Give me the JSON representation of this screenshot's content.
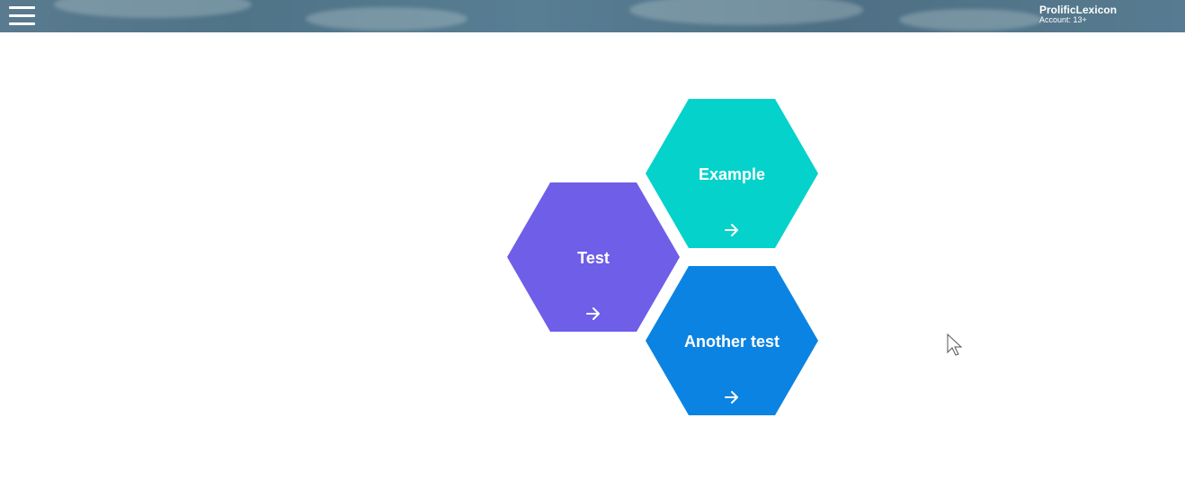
{
  "header": {
    "menu_icon": "hamburger-menu-icon",
    "account_name": "ProlificLexicon",
    "account_type": "Account: 13+"
  },
  "tiles": [
    {
      "label": "Example",
      "color": "#04d2cb",
      "icon": "arrow-right-icon"
    },
    {
      "label": "Test",
      "color": "#6e5ee8",
      "icon": "arrow-right-icon"
    },
    {
      "label": "Another test",
      "color": "#0b83e2",
      "icon": "arrow-right-icon"
    }
  ],
  "cursor": {
    "icon": "mouse-pointer-icon"
  }
}
